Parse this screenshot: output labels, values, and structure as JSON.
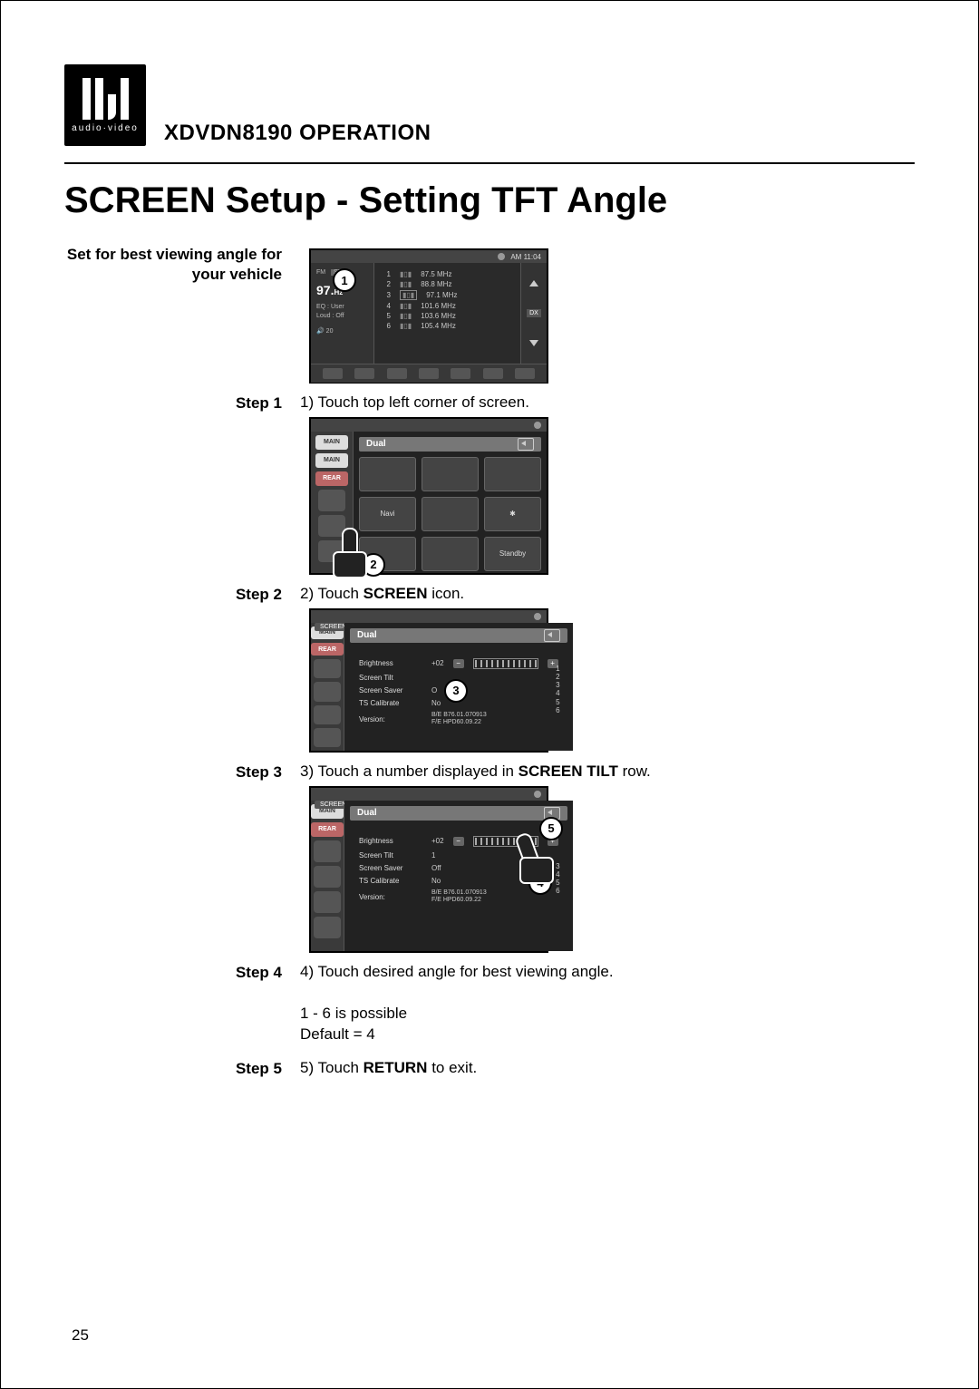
{
  "logo": {
    "brand_text": "audio·video",
    "mark": "®"
  },
  "model_line": {
    "model": "XDVDN8190",
    "word": "OPERATION"
  },
  "title": "SCREEN Setup - Setting TFT Angle",
  "intro_line1": "Set for best viewing angle for",
  "intro_line2": "your vehicle",
  "steps": {
    "s1": {
      "label": "Step 1",
      "text": "1) Touch top left corner of screen."
    },
    "s2": {
      "label": "Step 2",
      "pre": "2) Touch ",
      "bold": "SCREEN",
      "post": " icon."
    },
    "s3": {
      "label": "Step 3",
      "pre": "3) Touch a number displayed in ",
      "bold": "SCREEN TILT",
      "post": " row."
    },
    "s4": {
      "label": "Step 4",
      "l1": "4) Touch desired angle for best viewing angle.",
      "l2": "1 - 6  is possible",
      "l3": "Default = 4"
    },
    "s5": {
      "label": "Step 5",
      "pre": "5) Touch ",
      "bold": "RETURN",
      "post": " to exit."
    }
  },
  "callouts": {
    "c1": "1",
    "c2": "2",
    "c3": "3",
    "c4": "4",
    "c5": "5"
  },
  "radio": {
    "clock": "AM 11:04",
    "band": "FM",
    "st": "ST",
    "freq": "97.",
    "hz": "Hz",
    "eq": "EQ   : User",
    "loud": "Loud : Off",
    "vol": "20",
    "presets": [
      {
        "n": "1",
        "f": "87.5 MHz"
      },
      {
        "n": "2",
        "f": "88.8 MHz"
      },
      {
        "n": "3",
        "f": "97.1 MHz"
      },
      {
        "n": "4",
        "f": "101.6 MHz"
      },
      {
        "n": "5",
        "f": "103.6 MHz"
      },
      {
        "n": "6",
        "f": "105.4 MHz"
      }
    ],
    "dx": "DX"
  },
  "menu": {
    "side_main": "MAIN",
    "side_main2": "MAIN",
    "side_rear": "REAR",
    "hdr": "Dual",
    "tiles": {
      "navi": "Navi",
      "standby": "Standby"
    }
  },
  "screen_menu": {
    "tab": "SCREEN",
    "hdr": "Dual",
    "rows": {
      "brightness": {
        "lab": "Brightness",
        "val": "+02"
      },
      "tilt": {
        "lab": "Screen Tilt",
        "val3": "",
        "val4": "1"
      },
      "saver": {
        "lab": "Screen Saver",
        "val3": "O",
        "val4": "Off"
      },
      "calib": {
        "lab": "TS Calibrate",
        "val": "No"
      },
      "version": {
        "lab": "Version:",
        "v1": "B/E B76.01.070913",
        "v2": "F/E HPD60.09.22"
      }
    },
    "numcol": [
      "1",
      "2",
      "3",
      "4",
      "5",
      "6"
    ]
  },
  "page_number": "25"
}
